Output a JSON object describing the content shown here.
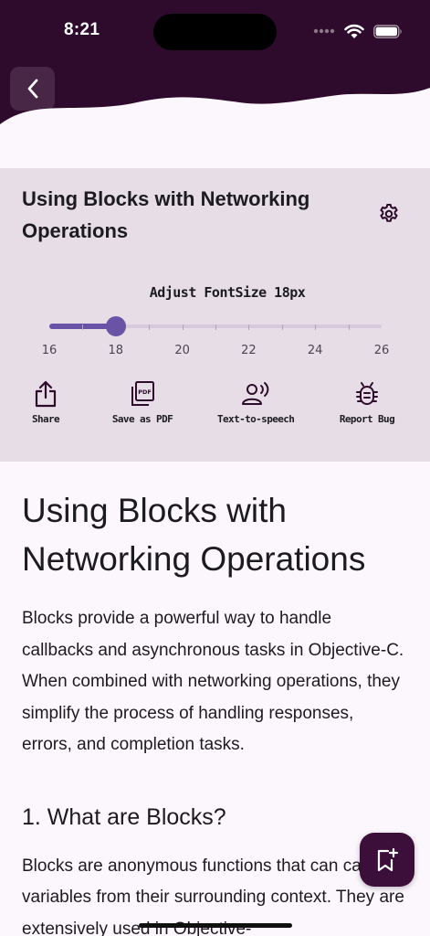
{
  "status_bar": {
    "time": "8:21",
    "icons": [
      "cellular-icon",
      "wifi-icon",
      "battery-icon"
    ]
  },
  "header": {
    "back_icon": "chevron-left-icon",
    "background_color": "#2e0a2c"
  },
  "settings_panel": {
    "title": "Using Blocks with Networking Operations",
    "settings_icon": "gear-icon",
    "font_size_label": "Adjust FontSize 18px",
    "slider": {
      "min": 16,
      "max": 26,
      "value": 18,
      "labels": [
        "16",
        "18",
        "20",
        "22",
        "24",
        "26"
      ],
      "accent": "#6a52a7"
    },
    "actions": [
      {
        "label": "Share",
        "icon": "share-icon"
      },
      {
        "label": "Save as PDF",
        "icon": "pdf-icon"
      },
      {
        "label": "Text-to-speech",
        "icon": "speaker-person-icon"
      },
      {
        "label": "Report Bug",
        "icon": "bug-icon"
      }
    ]
  },
  "article": {
    "title": "Using Blocks with Networking Operations",
    "intro": "Blocks provide a powerful way to handle callbacks and asynchronous tasks in Objective-C. When combined with networking operations, they simplify the process of handling responses, errors, and completion tasks.",
    "section_heading": "1. What are Blocks?",
    "section_text": "Blocks are anonymous functions that can capture variables from their surrounding context. They are extensively used in Objective-"
  },
  "fab": {
    "icon": "bookmark-add-icon",
    "color": "#3c0f3a"
  }
}
